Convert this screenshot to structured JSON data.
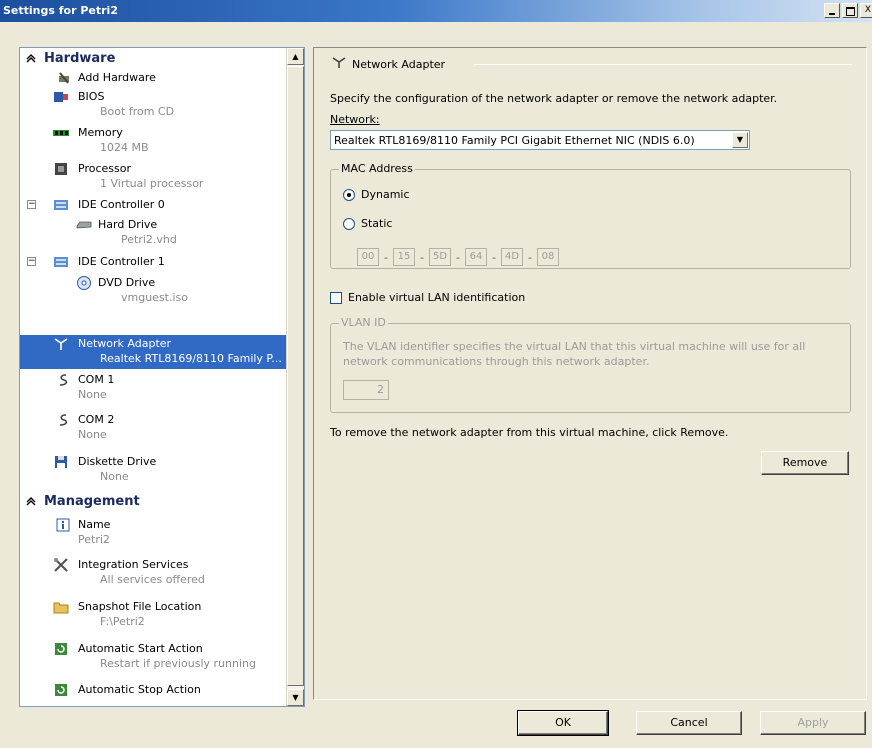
{
  "window": {
    "title": "Settings for Petri2",
    "minimize_label": "_",
    "maximize_label": "□",
    "close_label": "X"
  },
  "tree": {
    "hardware_label": "Hardware",
    "management_label": "Management",
    "expand_minus": "−",
    "scroll_up": "▲",
    "scroll_down": "▼",
    "items": [
      {
        "label": "Add Hardware",
        "sub": ""
      },
      {
        "label": "BIOS",
        "sub": "Boot from CD"
      },
      {
        "label": "Memory",
        "sub": "1024 MB"
      },
      {
        "label": "Processor",
        "sub": "1 Virtual processor"
      },
      {
        "label": "IDE Controller 0",
        "sub": ""
      },
      {
        "label": "Hard Drive",
        "sub": "Petri2.vhd"
      },
      {
        "label": "IDE Controller 1",
        "sub": ""
      },
      {
        "label": "DVD Drive",
        "sub": "vmguest.iso"
      },
      {
        "label": "Network Adapter",
        "sub": "Realtek RTL8169/8110 Family P..."
      },
      {
        "label": "COM 1",
        "sub": "None"
      },
      {
        "label": "COM 2",
        "sub": "None"
      },
      {
        "label": "Diskette Drive",
        "sub": "None"
      }
    ],
    "mgmt_items": [
      {
        "label": "Name",
        "sub": "Petri2"
      },
      {
        "label": "Integration Services",
        "sub": "All services offered"
      },
      {
        "label": "Snapshot File Location",
        "sub": "F:\\Petri2"
      },
      {
        "label": "Automatic Start Action",
        "sub": "Restart if previously running"
      },
      {
        "label": "Automatic Stop Action",
        "sub": ""
      }
    ]
  },
  "panel": {
    "section_title": "Network Adapter",
    "description": "Specify the configuration of the network adapter or remove the network adapter.",
    "network_label": "Network:",
    "network_value": "Realtek RTL8169/8110 Family PCI Gigabit Ethernet NIC (NDIS 6.0)",
    "dropdown_arrow": "▼",
    "mac_group_label": "MAC Address",
    "dynamic_label": "Dynamic",
    "static_label": "Static",
    "mac_octets": [
      "00",
      "15",
      "5D",
      "64",
      "4D",
      "08"
    ],
    "mac_separator": "-",
    "vlan_check_label": "Enable virtual LAN identification",
    "vlan_group_label": "VLAN ID",
    "vlan_desc_1": "The VLAN identifier specifies the virtual LAN that this virtual machine will use for all",
    "vlan_desc_2": "network communications through this network adapter.",
    "vlan_value": "2",
    "remove_text": "To remove the network adapter from this virtual machine, click Remove.",
    "remove_label": "Remove"
  },
  "footer": {
    "ok_label": "OK",
    "cancel_label": "Cancel",
    "apply_label": "Apply"
  }
}
